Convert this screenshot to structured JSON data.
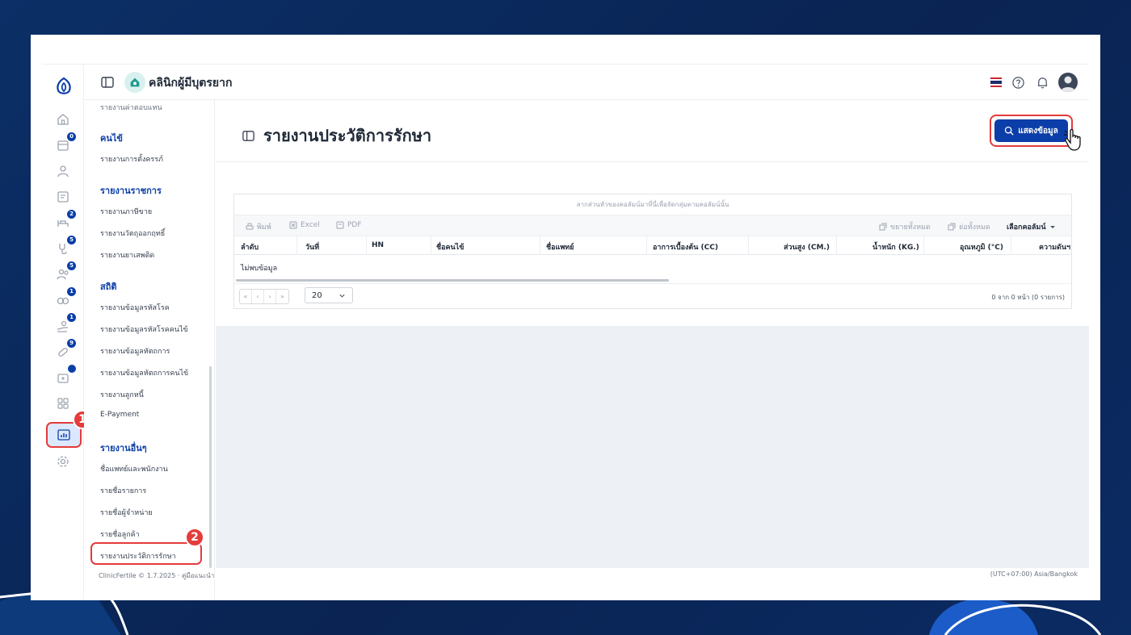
{
  "header": {
    "clinic_name": "คลินิกผู้มีบุตรยาก"
  },
  "rail": {
    "badges": [
      "0",
      "2",
      "5",
      "5",
      "1",
      "1",
      "9"
    ],
    "step_markers": [
      "1",
      "2"
    ]
  },
  "sidebar": {
    "top_item": "รายงานค่าตอบแทน",
    "sections": [
      {
        "title": "คนไข้",
        "items": [
          "รายงานการตั้งครรภ์"
        ]
      },
      {
        "title": "รายงานราชการ",
        "items": [
          "รายงานภาษีขาย",
          "รายงานวัตถุออกฤทธิ์",
          "รายงานยาเสพติด"
        ]
      },
      {
        "title": "สถิติ",
        "items": [
          "รายงานข้อมูลรหัสโรค",
          "รายงานข้อมูลรหัสโรคคนไข้",
          "รายงานข้อมูลหัตถการ",
          "รายงานข้อมูลหัตถการคนไข้",
          "รายงานลูกหนี้",
          "E-Payment"
        ]
      },
      {
        "title": "รายงานอื่นๆ",
        "items": [
          "ชื่อแพทย์และพนักงาน",
          "รายชื่อรายการ",
          "รายชื่อผู้จำหน่าย",
          "รายชื่อลูกค้า",
          "รายงานประวัติการรักษา"
        ]
      }
    ],
    "footer_left": "ClinicFertile © 1.7.2025 · คู่มือแนะนำ",
    "footer_right": "(UTC+07:00) Asia/Bangkok"
  },
  "main": {
    "page_title": "รายงานประวัติการรักษา",
    "show_button": "แสดงข้อมูล"
  },
  "grid": {
    "group_hint": "ลากส่วนหัวของคอลัมน์มาที่นี่เพื่อจัดกลุ่มตามคอลัมน์นั้น",
    "toolbar": {
      "print": "พิมพ์",
      "excel": "Excel",
      "pdf": "PDF",
      "expand_all": "ขยายทั้งหมด",
      "collapse_all": "ย่อทั้งหมด",
      "choose_columns": "เลือกคอลัมน์"
    },
    "columns": [
      "ลำดับ",
      "วันที่",
      "HN",
      "ชื่อคนไข้",
      "ชื่อแพทย์",
      "อาการเบื้องต้น (CC)",
      "ส่วนสูง (CM.)",
      "น้ำหนัก (KG.)",
      "อุณหภูมิ (°C)",
      "ความดันฯ"
    ],
    "empty_text": "ไม่พบข้อมูล",
    "page_size": "20",
    "pager_info": "0 จาก 0 หน้า (0 รายการ)"
  },
  "colors": {
    "primary": "#0b3ea8",
    "highlight": "#e43b3b",
    "background": "#0b2f66"
  }
}
